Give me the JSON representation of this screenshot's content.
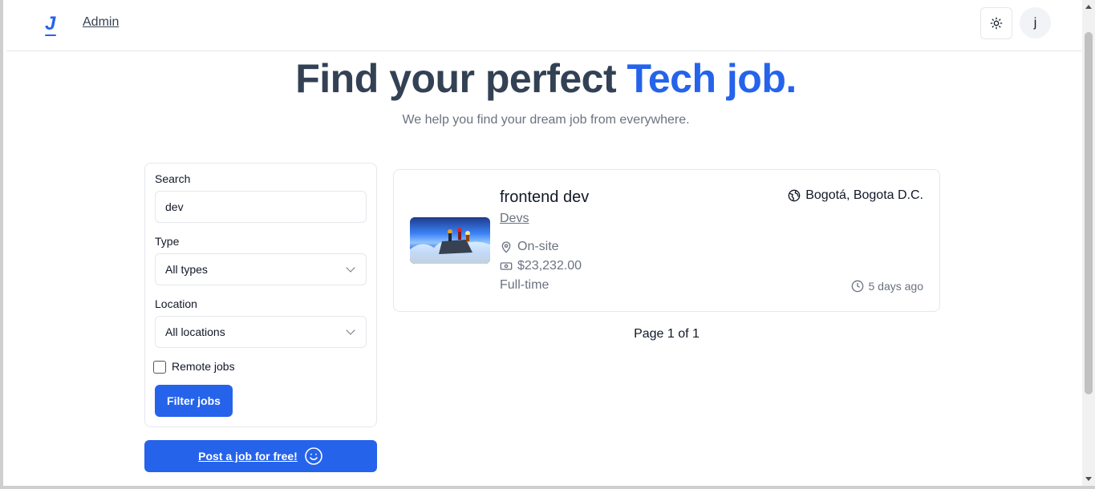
{
  "header": {
    "logo_letter": "J",
    "admin_link": "Admin",
    "theme_icon": "sun-icon",
    "avatar_letter": "j"
  },
  "hero": {
    "title_main": "Find your perfect",
    "title_accent": "Tech job.",
    "subtitle": "We help you find your dream job from everywhere."
  },
  "filters": {
    "search_label": "Search",
    "search_value": "dev",
    "type_label": "Type",
    "type_value": "All types",
    "location_label": "Location",
    "location_value": "All locations",
    "remote_label": "Remote jobs",
    "remote_checked": false,
    "filter_button": "Filter jobs"
  },
  "post_button": "Post a job for free!",
  "jobs": [
    {
      "title": "frontend dev",
      "company": "Devs",
      "location": "Bogotá, Bogota D.C.",
      "location_type": "On-site",
      "salary": "$23,232.00",
      "employment_type": "Full-time",
      "posted": "5 days ago"
    }
  ],
  "pagination": "Page 1 of 1",
  "colors": {
    "accent": "#2563eb",
    "title": "#334155",
    "muted": "#6b7280"
  }
}
